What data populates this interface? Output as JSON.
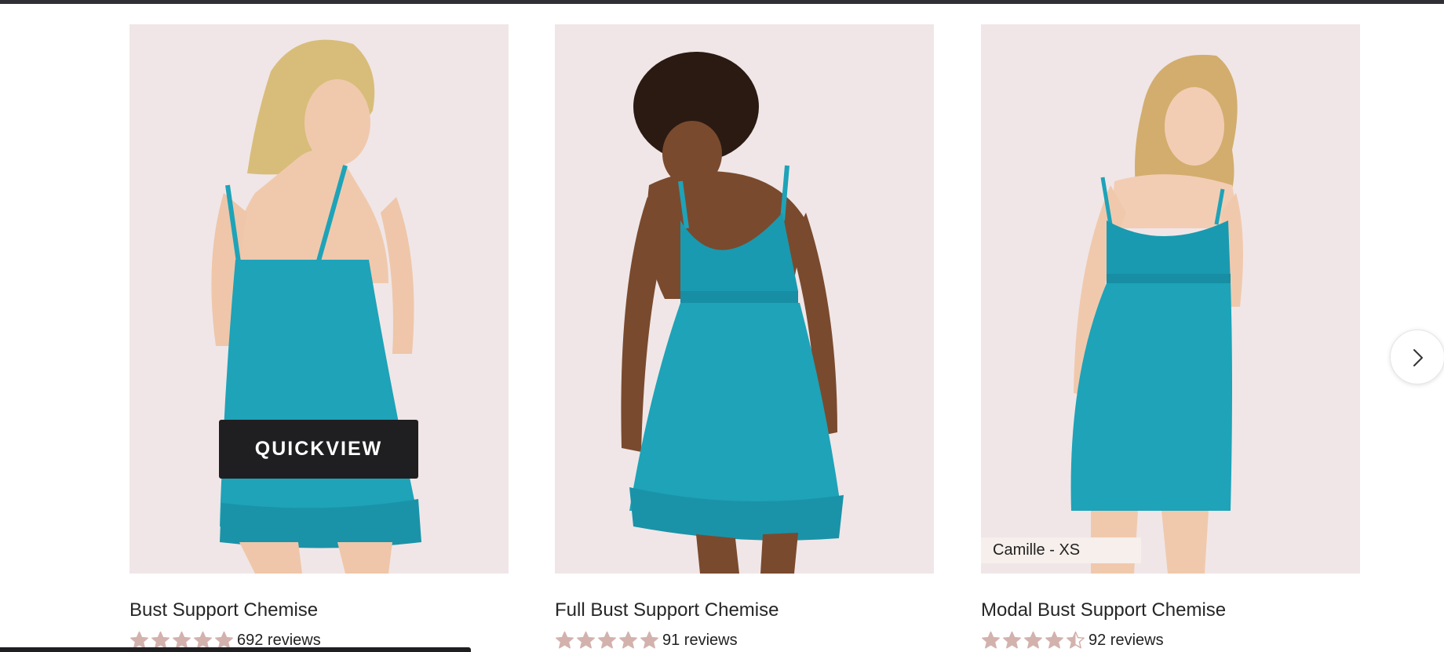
{
  "products": [
    {
      "name": "Bust Support Chemise",
      "rating": 5,
      "reviews_label": "692 reviews",
      "quickview_label": "QUICKVIEW",
      "model_tag": ""
    },
    {
      "name": "Full Bust Support Chemise",
      "rating": 5,
      "reviews_label": "91 reviews",
      "model_tag": ""
    },
    {
      "name": "Modal Bust Support Chemise",
      "rating": 4.5,
      "reviews_label": "92 reviews",
      "model_tag": "Camille - XS"
    }
  ],
  "carousel": {
    "next_icon": "chevron-right-icon"
  },
  "colors": {
    "photo_background": "#f0e6e7",
    "dress": "#1ea3b8",
    "star": "#d3b2ad",
    "quickview_bg": "#1f1f21"
  }
}
